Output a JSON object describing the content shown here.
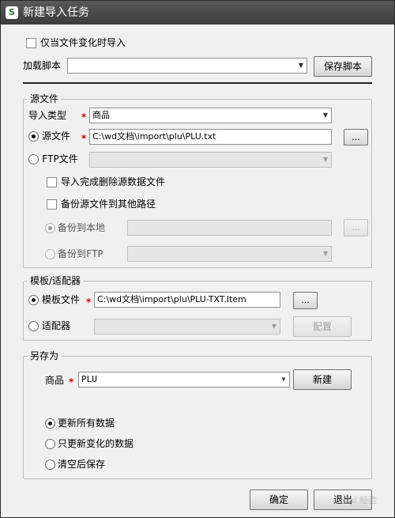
{
  "window": {
    "title": "新建导入任务",
    "icon_letter": "S"
  },
  "top": {
    "only_on_change_label": "仅当文件变化时导入",
    "load_script_label": "加载脚本",
    "load_script_value": "",
    "save_script_button": "保存脚本"
  },
  "source": {
    "group_title": "源文件",
    "import_type_label": "导入类型",
    "import_type_value": "商品",
    "source_file_label": "源文件",
    "source_file_path": "C:\\wd文档\\import\\plu\\PLU.txt",
    "browse_label": "...",
    "ftp_label": "FTP文件",
    "delete_after_label": "导入完成删除源数据文件",
    "backup_other_label": "备份源文件到其他路径",
    "backup_local_label": "备份到本地",
    "backup_ftp_label": "备份到FTP"
  },
  "template": {
    "group_title": "模板/适配器",
    "template_file_label": "模板文件",
    "template_file_path": "C:\\wd文档\\import\\plu\\PLU-TXT.Item",
    "browse_label": "...",
    "adapter_label": "适配器",
    "configure_button": "配置"
  },
  "save_as": {
    "group_title": "另存为",
    "product_label": "商品",
    "product_value": "PLU",
    "new_button": "新建",
    "opt_update_all": "更新所有数据",
    "opt_update_changed": "只更新变化的数据",
    "opt_clear_save": "清空后保存"
  },
  "footer": {
    "ok_button": "确定",
    "exit_button": "退出",
    "watermark": "Bai 经验"
  },
  "icons": {
    "dropdown": "chevron-down-icon"
  }
}
